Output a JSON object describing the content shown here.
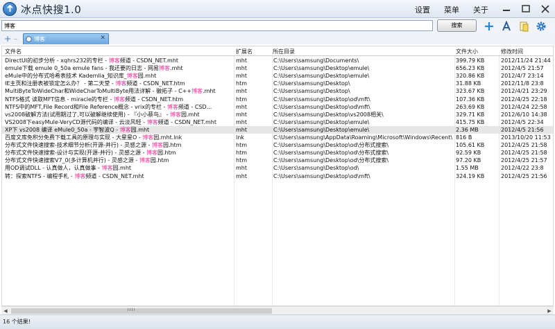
{
  "app": {
    "title": "冰点快搜1.0"
  },
  "menu": [
    "设置",
    "菜单",
    "关于"
  ],
  "search": {
    "value": "博客",
    "button": "搜索"
  },
  "tab": {
    "label": "博客"
  },
  "columns": [
    "文件名",
    "扩展名",
    "所在目录",
    "文件大小",
    "修改时间"
  ],
  "rows": [
    {
      "name": [
        "DirectUI的初步分析 - xqhrs232的专栏 - ",
        "博客",
        "频道 - CSDN_NET.mht"
      ],
      "ext": "mht",
      "dir": "C:\\Users\\samsung\\Documents\\",
      "size": "399.79 KB",
      "time": "2012/11/24 21:44"
    },
    {
      "name": [
        "emule下载 emule 0_50a emule fans - 我还要的日志 - 网易",
        "博客",
        ".mht"
      ],
      "ext": "mht",
      "dir": "C:\\Users\\samsung\\Desktop\\emule\\",
      "size": "656.23 KB",
      "time": "2012/4/5 21:57"
    },
    {
      "name": [
        "eMule中的分布式哈希表技术 Kademlia_知识库_",
        "博客",
        "园.mht"
      ],
      "ext": "mht",
      "dir": "C:\\Users\\samsung\\Desktop\\emule\\",
      "size": "320.86 KB",
      "time": "2012/4/7 23:14"
    },
    {
      "name": [
        "IE主页和注册表被锁定怎么办？ - 第二天堂 - ",
        "博客",
        "频道 - CSDN_NET.htm"
      ],
      "ext": "htm",
      "dir": "C:\\Users\\samsung\\Desktop\\",
      "size": "31.88 KB",
      "time": "2012/11/8 23:8"
    },
    {
      "name": [
        "MultiByteToWideChar和WideCharToMultiByte用法详解 - 徽拓子 - C++",
        "博客",
        ".mht"
      ],
      "ext": "mht",
      "dir": "C:\\Users\\samsung\\Desktop\\",
      "size": "323.67 KB",
      "time": "2012/4/21 23:29"
    },
    {
      "name": [
        "NTFS格式 读取MFT信息 - miracle的专栏 - ",
        "博客",
        "频道 - CSDN_NET.htm"
      ],
      "ext": "htm",
      "dir": "C:\\Users\\samsung\\Desktop\\od\\mft\\",
      "size": "107.36 KB",
      "time": "2012/4/25 22:18"
    },
    {
      "name": [
        "NTFS中的MFT,File Record和File Reference概念 - vrix的专栏 - ",
        "博客",
        "频道 - CSD..."
      ],
      "ext": "mht",
      "dir": "C:\\Users\\samsung\\Desktop\\od\\mft\\",
      "size": "263.69 KB",
      "time": "2012/4/24 22:58"
    },
    {
      "name": [
        "vs2008破解方法(试用期过了,可以破解继续使用) - 『小小蔡鸟』 - ",
        "博客",
        "园.mht"
      ],
      "ext": "mht",
      "dir": "C:\\Users\\samsung\\Desktop\\vs2008相关\\",
      "size": "329.71 KB",
      "time": "2012/6/10 14:38"
    },
    {
      "name": [
        "VS2008下easyMule-VeryCD源代码的编译 - 云淡风轻 - ",
        "博客",
        "频道 - CSDN_NET.mht"
      ],
      "ext": "mht",
      "dir": "C:\\Users\\samsung\\Desktop\\emule\\",
      "size": "415.75 KB",
      "time": "2012/4/5 22:34"
    },
    {
      "name": [
        "XP下 vs2008 编译 eMule0_50a - 宇智波Q - ",
        "博客",
        "园.mht"
      ],
      "ext": "mht",
      "dir": "C:\\Users\\samsung\\Desktop\\emule\\",
      "size": "2.36 MB",
      "time": "2012/4/5 21:56",
      "selected": true
    },
    {
      "name": [
        "百度文库免积分免费下载工具的原理与实现 - 大星星O - ",
        "博客",
        "园.mht.lnk"
      ],
      "ext": "lnk",
      "dir": "C:\\Users\\samsung\\AppData\\Roaming\\Microsoft\\Windows\\Recent\\",
      "size": "816 B",
      "time": "2013/10/20 11:53"
    },
    {
      "name": [
        "分布式文件快速搜索-技术细节分析(开源-并行) - 灵感之源 - ",
        "博客",
        "园.htm"
      ],
      "ext": "htm",
      "dir": "C:\\Users\\samsung\\Desktop\\od\\分布式搜索\\",
      "size": "105.61 KB",
      "time": "2012/4/25 21:58"
    },
    {
      "name": [
        "分布式文件快速搜索-设计与实现(开源-并行) - 灵感之源 - ",
        "博客",
        "园.htm"
      ],
      "ext": "htm",
      "dir": "C:\\Users\\samsung\\Desktop\\od\\分布式搜索\\",
      "size": "92.59 KB",
      "time": "2012/4/25 21:58"
    },
    {
      "name": [
        "分布式文件快速搜索V7_0(多计算机并行) - 灵感之源 - ",
        "博客",
        "园.htm"
      ],
      "ext": "htm",
      "dir": "C:\\Users\\samsung\\Desktop\\od\\分布式搜索\\",
      "size": "97.20 KB",
      "time": "2012/4/25 21:57"
    },
    {
      "name": [
        "用OD调试DLL - 认真做人，认真做事 - ",
        "博客",
        "园.mht"
      ],
      "ext": "mht",
      "dir": "C:\\Users\\samsung\\Desktop\\od\\",
      "size": "1.55 MB",
      "time": "2012/4/22 23:8"
    },
    {
      "name": [
        "转：探索NTFS - 编程手札 - ",
        "博客",
        "频道 - CSDN_NET.mht"
      ],
      "ext": "mht",
      "dir": "C:\\Users\\samsung\\Desktop\\od\\mft\\",
      "size": "324.19 KB",
      "time": "2012/4/25 21:56"
    }
  ],
  "status": {
    "text": "16 个结果!"
  }
}
